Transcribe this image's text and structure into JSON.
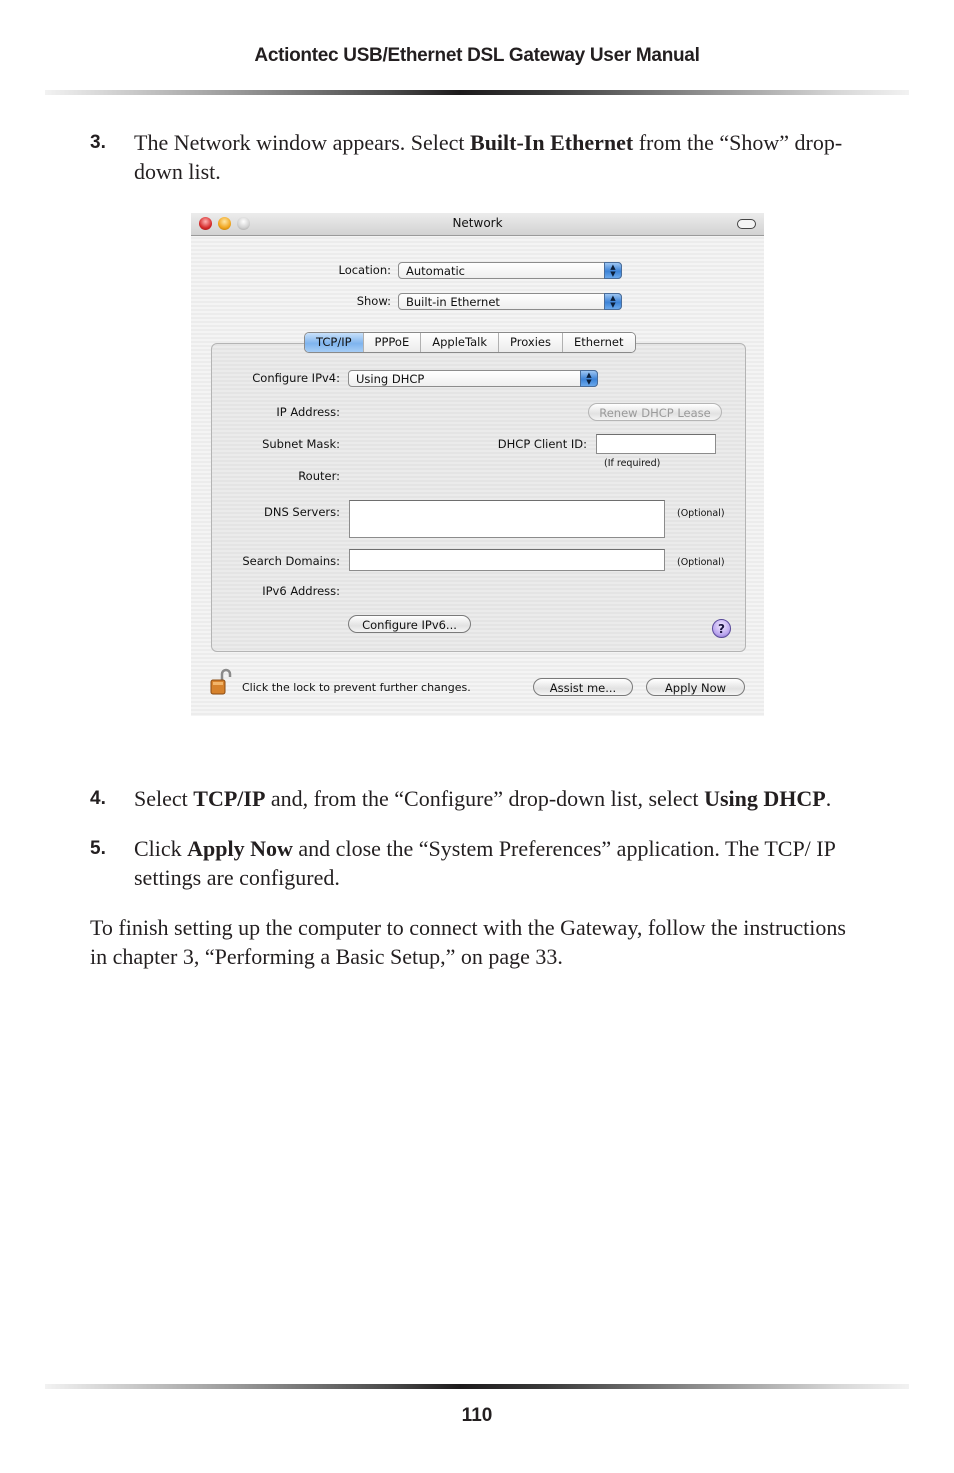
{
  "header": {
    "title": "Actiontec USB/Ethernet DSL Gateway User Manual"
  },
  "steps": [
    {
      "number": "3.",
      "parts": [
        {
          "t": "The Network window appears. Select "
        },
        {
          "b": "Built-In Ethernet"
        },
        {
          "t": " from the “Show” drop-down list."
        }
      ]
    },
    {
      "number": "4.",
      "parts": [
        {
          "t": "Select "
        },
        {
          "b": "TCP/IP"
        },
        {
          "t": " and, from the “Configure” drop-down list, select "
        },
        {
          "b": "Using DHCP"
        },
        {
          "t": "."
        }
      ]
    },
    {
      "number": "5.",
      "parts": [
        {
          "t": "Click "
        },
        {
          "b": "Apply Now"
        },
        {
          "t": " and close the “System Preferences” application. The TCP/ IP settings are configured."
        }
      ]
    }
  ],
  "closing_paragraph": "To finish setting up the computer to connect with the Gateway, follow the instructions in chapter 3, “Performing a Basic Setup,” on page 33.",
  "page_number": "110",
  "window": {
    "title": "Network",
    "location_label": "Location:",
    "location_value": "Automatic",
    "show_label": "Show:",
    "show_value": "Built-in Ethernet",
    "tabs": [
      {
        "label": "TCP/IP",
        "active": true
      },
      {
        "label": "PPPoE",
        "active": false
      },
      {
        "label": "AppleTalk",
        "active": false
      },
      {
        "label": "Proxies",
        "active": false
      },
      {
        "label": "Ethernet",
        "active": false
      }
    ],
    "configure_ipv4_label": "Configure IPv4:",
    "configure_ipv4_value": "Using DHCP",
    "ip_address_label": "IP Address:",
    "renew_dhcp_label": "Renew DHCP Lease",
    "subnet_mask_label": "Subnet Mask:",
    "dhcp_client_id_label": "DHCP Client ID:",
    "dhcp_client_id_value": "",
    "if_required_note": "(If required)",
    "router_label": "Router:",
    "dns_servers_label": "DNS Servers:",
    "dns_servers_value": "",
    "optional_note": "(Optional)",
    "search_domains_label": "Search Domains:",
    "search_domains_value": "",
    "ipv6_address_label": "IPv6 Address:",
    "configure_ipv6_label": "Configure IPv6...",
    "help_label": "?",
    "lock_text": "Click the lock to prevent further changes.",
    "assist_label": "Assist me...",
    "apply_label": "Apply Now"
  }
}
